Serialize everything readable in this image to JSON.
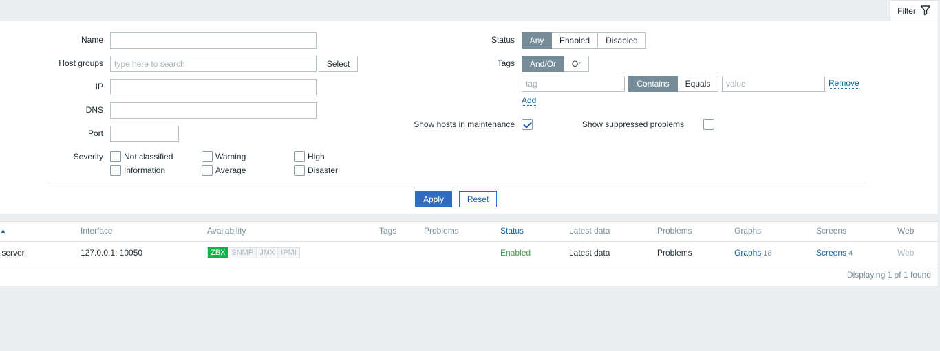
{
  "filter_tab": {
    "label": "Filter",
    "icon": "funnel-icon"
  },
  "filter": {
    "name": {
      "label": "Name",
      "value": ""
    },
    "host_groups": {
      "label": "Host groups",
      "placeholder": "type here to search",
      "select_label": "Select"
    },
    "ip": {
      "label": "IP",
      "value": ""
    },
    "dns": {
      "label": "DNS",
      "value": ""
    },
    "port": {
      "label": "Port",
      "value": ""
    },
    "severity": {
      "label": "Severity",
      "options": [
        "Not classified",
        "Warning",
        "High",
        "Information",
        "Average",
        "Disaster"
      ]
    },
    "status": {
      "label": "Status",
      "options": [
        "Any",
        "Enabled",
        "Disabled"
      ],
      "selected": "Any"
    },
    "tags": {
      "label": "Tags",
      "operator_options": [
        "And/Or",
        "Or"
      ],
      "operator_selected": "And/Or",
      "tag_placeholder": "tag",
      "match_options": [
        "Contains",
        "Equals"
      ],
      "match_selected": "Contains",
      "value_placeholder": "value",
      "remove_label": "Remove",
      "add_label": "Add"
    },
    "maintenance": {
      "label": "Show hosts in maintenance",
      "checked": true
    },
    "suppressed": {
      "label": "Show suppressed problems",
      "checked": false
    },
    "apply_label": "Apply",
    "reset_label": "Reset"
  },
  "table": {
    "headers": {
      "name": "",
      "interface": "Interface",
      "availability": "Availability",
      "tags": "Tags",
      "problems": "Problems",
      "status": "Status",
      "latest_data": "Latest data",
      "problems2": "Problems",
      "graphs": "Graphs",
      "screens": "Screens",
      "web": "Web"
    },
    "rows": [
      {
        "name": "x server",
        "interface": "127.0.0.1: 10050",
        "availability": [
          "ZBX",
          "SNMP",
          "JMX",
          "IPMI"
        ],
        "status": "Enabled",
        "latest_data": "Latest data",
        "problems": "Problems",
        "graphs": "Graphs",
        "graphs_count": "18",
        "screens": "Screens",
        "screens_count": "4",
        "web": "Web"
      }
    ],
    "footer": "Displaying 1 of 1 found"
  },
  "colors": {
    "accent": "#2f6bbf",
    "toggle_on": "#768d99",
    "zbx_ok": "#0eb449",
    "status_enabled": "#429e47"
  }
}
